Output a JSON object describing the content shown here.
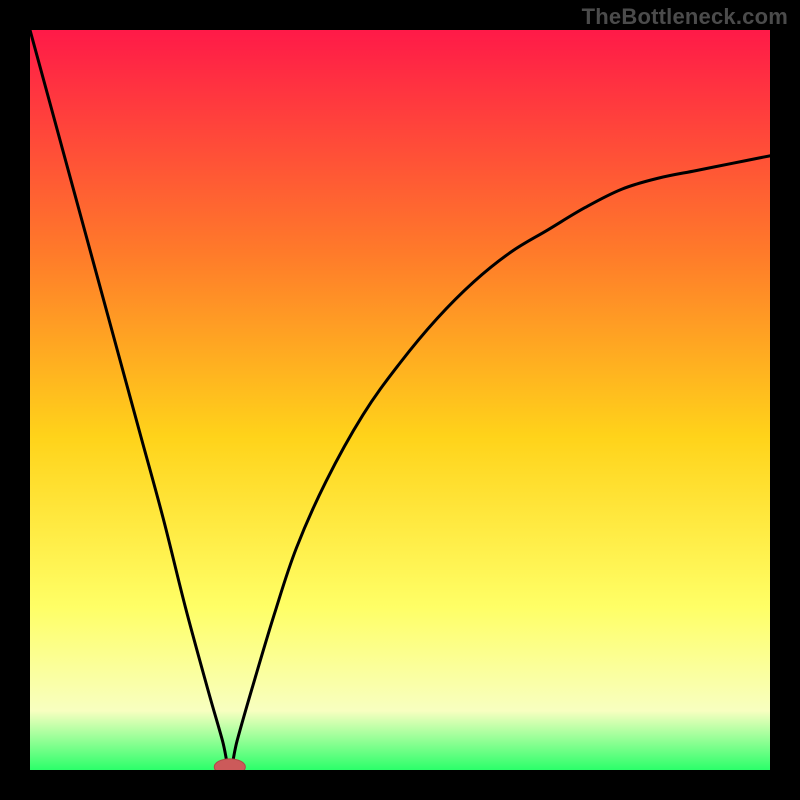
{
  "watermark": "TheBottleneck.com",
  "colors": {
    "frame_bg": "#000000",
    "gradient_top": "#ff1a48",
    "gradient_mid1": "#ff7a2a",
    "gradient_mid2": "#ffd31a",
    "gradient_low": "#ffff66",
    "gradient_pale": "#f8ffc0",
    "gradient_bottom": "#2bff6a",
    "curve_stroke": "#000000",
    "marker_fill": "#cc5a5a",
    "marker_stroke": "#b24848"
  },
  "chart_data": {
    "type": "line",
    "title": "",
    "xlabel": "",
    "ylabel": "",
    "xlim": [
      0,
      100
    ],
    "ylim": [
      0,
      100
    ],
    "grid": false,
    "legend": false,
    "notes": "V-shaped bottleneck curve; minimum ≈ 0 near x≈27; left branch nearly linear to 100 at x=0; right branch concave rising toward ≈83 at x=100.",
    "minimum": {
      "x": 27,
      "y": 0
    },
    "marker": {
      "x": 27,
      "y": 0,
      "rx": 2.1,
      "ry": 1.1
    },
    "series": [
      {
        "name": "bottleneck-curve",
        "x": [
          0,
          3,
          6,
          9,
          12,
          15,
          18,
          21,
          24,
          26,
          27,
          28,
          30,
          33,
          36,
          40,
          45,
          50,
          55,
          60,
          65,
          70,
          75,
          80,
          85,
          90,
          95,
          100
        ],
        "y": [
          100,
          89,
          78,
          67,
          56,
          45,
          34,
          22,
          11,
          4,
          0,
          4,
          11,
          21,
          30,
          39,
          48,
          55,
          61,
          66,
          70,
          73,
          76,
          78.5,
          80,
          81,
          82,
          83
        ]
      }
    ]
  }
}
